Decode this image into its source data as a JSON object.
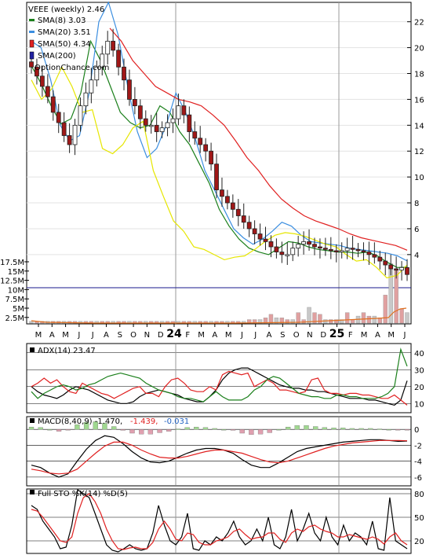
{
  "chart_data": [
    {
      "type": "candlestick",
      "panel": "price",
      "title": "VEEE (weekly) 2.46",
      "watermark": "OptionChance.com",
      "legend": [
        {
          "label": "SMA(8) 3.03",
          "color": "#1a7f1a",
          "style": "line"
        },
        {
          "label": "SMA(20) 3.51",
          "color": "#3b8ee0",
          "style": "line"
        },
        {
          "label": "SMA(50) 4.34",
          "color": "#e02020",
          "style": "candle"
        },
        {
          "label": "SMA(200)",
          "color": "#2020a0",
          "style": "candle"
        }
      ],
      "x_ticks": [
        "M",
        "A",
        "M",
        "J",
        "J",
        "A",
        "S",
        "O",
        "N",
        "D",
        "24",
        "F",
        "M",
        "A",
        "M",
        "J",
        "J",
        "A",
        "S",
        "O",
        "N",
        "D",
        "25",
        "F",
        "M",
        "A",
        "M",
        "J"
      ],
      "ylim": [
        1.5,
        23.5
      ],
      "y_ticks": [
        4,
        6,
        8,
        10,
        12,
        14,
        16,
        18,
        20,
        22
      ],
      "volume_ticks": [
        "17.5M",
        "15M",
        "12.5M",
        "10M",
        "7.5M",
        "5M",
        "2.5M"
      ],
      "series": [
        {
          "name": "SMA(8)",
          "color": "#1a7f1a",
          "values": [
            18.6,
            17.2,
            15.5,
            14.1,
            14.5,
            16.5,
            20.5,
            19.0,
            17.0,
            15.0,
            14.2,
            13.8,
            14.0,
            15.5,
            15.0,
            13.5,
            12.5,
            11.0,
            9.5,
            7.5,
            6.2,
            5.2,
            4.5,
            4.2,
            4.0,
            4.5,
            5.0,
            4.9,
            4.6,
            4.4,
            4.3,
            4.2,
            4.2,
            4.1,
            4.2,
            3.9,
            3.4,
            3.0,
            3.03
          ]
        },
        {
          "name": "SMA(20)",
          "color": "#3b8ee0",
          "values": [
            20.5,
            20.0,
            17.5,
            14.0,
            12.8,
            13.2,
            16.5,
            22.0,
            23.5,
            21.0,
            17.0,
            13.5,
            11.5,
            12.2,
            14.0,
            16.5,
            15.0,
            13.0,
            10.5,
            9.0,
            7.5,
            6.0,
            5.3,
            4.8,
            5.2,
            5.8,
            6.5,
            6.2,
            5.5,
            5.0,
            4.9,
            4.8,
            4.7,
            4.5,
            4.4,
            4.3,
            4.2,
            4.1,
            3.9,
            3.51
          ]
        },
        {
          "name": "SMA(50)",
          "color": "#e02020",
          "values": [
            21.5,
            20.5,
            19.0,
            18.0,
            17.0,
            16.5,
            16.0,
            15.8,
            15.5,
            14.8,
            14.0,
            12.8,
            11.5,
            10.5,
            9.3,
            8.3,
            7.6,
            7.0,
            6.6,
            6.3,
            6.0,
            5.6,
            5.3,
            5.1,
            4.9,
            4.7,
            4.34
          ]
        },
        {
          "name": "Bollinger band",
          "color": "#e6e600",
          "values": [
            17.5,
            16.0,
            16.8,
            18.5,
            17.0,
            15.0,
            15.2,
            12.2,
            11.8,
            12.5,
            13.8,
            14.3,
            10.5,
            8.5,
            6.6,
            5.8,
            4.6,
            4.4,
            4.0,
            3.6,
            3.8,
            3.9,
            4.4,
            5.0,
            5.5,
            5.7,
            5.6,
            5.4,
            5.1,
            4.8,
            4.6,
            4.0,
            3.5,
            3.6,
            3.0,
            2.2,
            2.4,
            3.2
          ]
        },
        {
          "name": "Close",
          "color": "#000000",
          "values": [
            18.5,
            17.8,
            17.0,
            16.2,
            15.0,
            14.2,
            13.2,
            12.5,
            14.0,
            15.5,
            16.5,
            17.5,
            18.5,
            19.5,
            20.5,
            19.8,
            18.5,
            17.5,
            16.0,
            15.5,
            14.5,
            14.0,
            14.0,
            13.5,
            13.8,
            14.2,
            14.5,
            15.5,
            14.8,
            13.5,
            13.0,
            12.5,
            12.0,
            11.0,
            9.0,
            8.5,
            8.0,
            7.5,
            7.0,
            6.5,
            6.0,
            5.6,
            5.2,
            5.0,
            4.6,
            4.2,
            4.0,
            4.0,
            4.5,
            4.8,
            5.0,
            4.8,
            4.6,
            4.5,
            4.4,
            4.3,
            4.2,
            4.3,
            4.5,
            4.4,
            4.3,
            4.2,
            4.0,
            3.8,
            3.5,
            3.2,
            2.9,
            2.8,
            3.0,
            2.46
          ]
        },
        {
          "name": "Volume",
          "color": "#d08080",
          "values": [
            0.5,
            0.5,
            0.5,
            0.5,
            0.5,
            0.5,
            0.5,
            0.5,
            0.5,
            0.5,
            0.5,
            0.5,
            0.5,
            0.5,
            0.5,
            0.5,
            0.5,
            0.5,
            0.5,
            0.5,
            0.5,
            0.5,
            0.5,
            0.5,
            0.5,
            0.5,
            0.5,
            0.5,
            0.5,
            0.5,
            0.5,
            0.5,
            0.5,
            0.5,
            0.5,
            0.5,
            0.5,
            0.5,
            0.5,
            0.5,
            1.0,
            1.0,
            1.0,
            1.5,
            2.5,
            1.5,
            1.5,
            1.0,
            1.0,
            3.0,
            1.0,
            4.5,
            3.0,
            2.5,
            1.0,
            1.0,
            1.0,
            1.0,
            3.0,
            1.0,
            2.0,
            3.0,
            2.0,
            2.0,
            1.5,
            8.0,
            17.0,
            15.5,
            4.0,
            3.0
          ]
        }
      ]
    },
    {
      "type": "line",
      "panel": "adx",
      "title": "ADX(14) 23.47",
      "ylim": [
        5,
        45
      ],
      "y_ticks": [
        10,
        20,
        30,
        40
      ],
      "series": [
        {
          "name": "ADX",
          "color": "#000000",
          "values": [
            20,
            17,
            15,
            14,
            13,
            15,
            18,
            20,
            19,
            18,
            16,
            14,
            12,
            11,
            10,
            10,
            11,
            14,
            16,
            17,
            18,
            17,
            16,
            15,
            13,
            12,
            11,
            11,
            14,
            18,
            24,
            28,
            30,
            31,
            31,
            29,
            27,
            25,
            23,
            21,
            20,
            19,
            19,
            18,
            18,
            17,
            17,
            16,
            15,
            14,
            13,
            13,
            13,
            12,
            12,
            11,
            10,
            9,
            12,
            23.47
          ]
        },
        {
          "name": "+DI",
          "color": "#e02020",
          "values": [
            20,
            22,
            25,
            22,
            24,
            20,
            17,
            16,
            22,
            20,
            18,
            16,
            15,
            13,
            15,
            17,
            19,
            20,
            16,
            16,
            14,
            20,
            24,
            25,
            22,
            18,
            17,
            17,
            20,
            18,
            27,
            29,
            28,
            27,
            28,
            20,
            22,
            24,
            22,
            18,
            18,
            17,
            16,
            17,
            24,
            25,
            18,
            16,
            16,
            15,
            16,
            16,
            15,
            15,
            14,
            13,
            13,
            15,
            12,
            9
          ]
        },
        {
          "name": "-DI",
          "color": "#1a7f1a",
          "values": [
            17,
            13,
            16,
            18,
            20,
            21,
            20,
            18,
            19,
            21,
            22,
            24,
            26,
            27,
            28,
            27,
            26,
            25,
            22,
            20,
            18,
            17,
            16,
            14,
            13,
            13,
            12,
            11,
            14,
            17,
            14,
            12,
            12,
            12,
            14,
            18,
            20,
            24,
            26,
            25,
            22,
            19,
            16,
            15,
            14,
            14,
            13,
            13,
            15,
            15,
            14,
            14,
            13,
            13,
            13,
            14,
            16,
            20,
            42,
            32
          ]
        }
      ]
    },
    {
      "type": "line",
      "panel": "macd",
      "title": "MACD(8,40,9) -1.470,",
      "labels": [
        {
          "text": "-1.439,",
          "color": "#e02020"
        },
        {
          "text": "-0.031",
          "color": "#2060c0"
        }
      ],
      "ylim": [
        -7,
        1.5
      ],
      "y_ticks": [
        0,
        -2,
        -4,
        -6
      ],
      "series": [
        {
          "name": "MACD",
          "color": "#000000",
          "values": [
            -4.5,
            -4.8,
            -5.5,
            -6.0,
            -5.6,
            -4.0,
            -2.5,
            -1.4,
            -0.8,
            -1.0,
            -1.8,
            -2.8,
            -3.6,
            -4.1,
            -4.2,
            -4.0,
            -3.5,
            -3.0,
            -2.6,
            -2.4,
            -2.4,
            -2.6,
            -3.0,
            -3.8,
            -4.5,
            -4.8,
            -4.8,
            -4.2,
            -3.5,
            -2.8,
            -2.4,
            -2.2,
            -2.0,
            -1.8,
            -1.6,
            -1.5,
            -1.4,
            -1.3,
            -1.3,
            -1.4,
            -1.5,
            -1.47
          ]
        },
        {
          "name": "Signal",
          "color": "#e02020",
          "values": [
            -5.0,
            -5.2,
            -5.5,
            -5.6,
            -5.5,
            -5.0,
            -4.0,
            -3.0,
            -2.1,
            -1.6,
            -1.6,
            -2.0,
            -2.6,
            -3.1,
            -3.5,
            -3.6,
            -3.6,
            -3.4,
            -3.1,
            -2.8,
            -2.6,
            -2.6,
            -2.8,
            -3.0,
            -3.4,
            -3.8,
            -4.1,
            -4.2,
            -4.0,
            -3.6,
            -3.2,
            -2.8,
            -2.4,
            -2.1,
            -1.9,
            -1.7,
            -1.6,
            -1.5,
            -1.4,
            -1.4,
            -1.4,
            -1.44
          ]
        }
      ]
    },
    {
      "type": "line",
      "panel": "stochastic",
      "title": "Full STO %K(14) %D(5)",
      "ylim": [
        5,
        85
      ],
      "y_ticks": [
        20,
        50,
        80
      ],
      "series": [
        {
          "name": "%K",
          "color": "#000000",
          "values": [
            65,
            60,
            45,
            35,
            25,
            10,
            12,
            40,
            85,
            80,
            75,
            55,
            35,
            15,
            8,
            6,
            10,
            15,
            10,
            8,
            10,
            30,
            65,
            40,
            20,
            15,
            25,
            55,
            10,
            8,
            20,
            15,
            25,
            20,
            30,
            45,
            25,
            15,
            20,
            35,
            20,
            50,
            15,
            10,
            25,
            60,
            20,
            35,
            55,
            30,
            20,
            50,
            25,
            15,
            40,
            20,
            30,
            25,
            15,
            45,
            10,
            8,
            75,
            20,
            15,
            10
          ]
        },
        {
          "name": "%D",
          "color": "#e02020",
          "values": [
            60,
            58,
            50,
            40,
            30,
            20,
            18,
            25,
            55,
            75,
            80,
            70,
            55,
            35,
            20,
            10,
            9,
            11,
            12,
            10,
            10,
            18,
            35,
            45,
            35,
            22,
            20,
            30,
            28,
            18,
            15,
            15,
            20,
            22,
            25,
            32,
            35,
            28,
            22,
            24,
            25,
            30,
            30,
            22,
            18,
            30,
            35,
            32,
            38,
            40,
            35,
            32,
            30,
            25,
            25,
            28,
            26,
            24,
            22,
            25,
            22,
            16,
            25,
            30,
            20,
            15
          ]
        }
      ]
    }
  ]
}
